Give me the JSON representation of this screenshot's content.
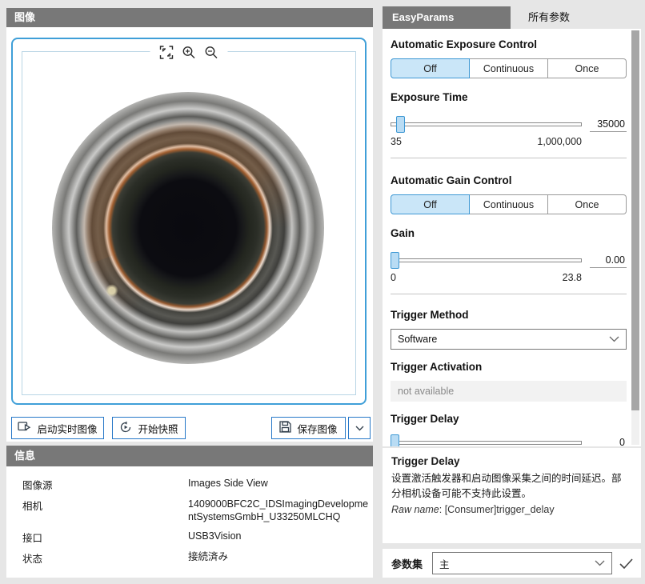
{
  "colors": {
    "accent_blue": "#2778c8",
    "viewport_border": "#3f9fd8",
    "header_gray": "#787878",
    "segment_selected_bg": "#cae6f8",
    "segment_selected_border": "#3e98d4"
  },
  "left": {
    "image_panel": {
      "title": "图像",
      "toolbar": {
        "fit_icon": "fit-to-window",
        "zoom_in_icon": "zoom-in",
        "zoom_out_icon": "zoom-out"
      },
      "buttons": {
        "start_live": "启动实时图像",
        "start_snapshot": "开始快照",
        "save_image": "保存图像"
      }
    },
    "info_panel": {
      "title": "信息",
      "rows": [
        {
          "label": "图像源",
          "value": "Images Side View"
        },
        {
          "label": "相机",
          "value": "1409000BFC2C_IDSImagingDevelopmentSystemsGmbH_U33250MLCHQ"
        },
        {
          "label": "接口",
          "value": "USB3Vision"
        },
        {
          "label": "状态",
          "value": "接続済み"
        }
      ]
    }
  },
  "right": {
    "tabs": [
      {
        "label": "EasyParams"
      },
      {
        "label": "所有参数"
      }
    ],
    "sections": {
      "aec": {
        "title": "Automatic Exposure Control",
        "options": [
          "Off",
          "Continuous",
          "Once"
        ],
        "selected": "Off"
      },
      "exposure": {
        "title": "Exposure Time",
        "value": "35000",
        "min": "35",
        "max": "1,000,000"
      },
      "agc": {
        "title": "Automatic Gain Control",
        "options": [
          "Off",
          "Continuous",
          "Once"
        ],
        "selected": "Off"
      },
      "gain": {
        "title": "Gain",
        "value": "0.00",
        "min": "0",
        "max": "23.8"
      },
      "trigger_method": {
        "title": "Trigger Method",
        "value": "Software"
      },
      "trigger_activation": {
        "title": "Trigger Activation",
        "value": "not available"
      },
      "trigger_delay": {
        "title": "Trigger Delay",
        "value": "0"
      }
    },
    "description": {
      "title": "Trigger Delay",
      "text": "设置激活触发器和启动图像采集之间的时间延迟。部分相机设备可能不支持此设置。",
      "raw_label": "Raw name",
      "raw_value": ": [Consumer]trigger_delay"
    },
    "param_set": {
      "label": "参数集",
      "value": "主"
    }
  }
}
